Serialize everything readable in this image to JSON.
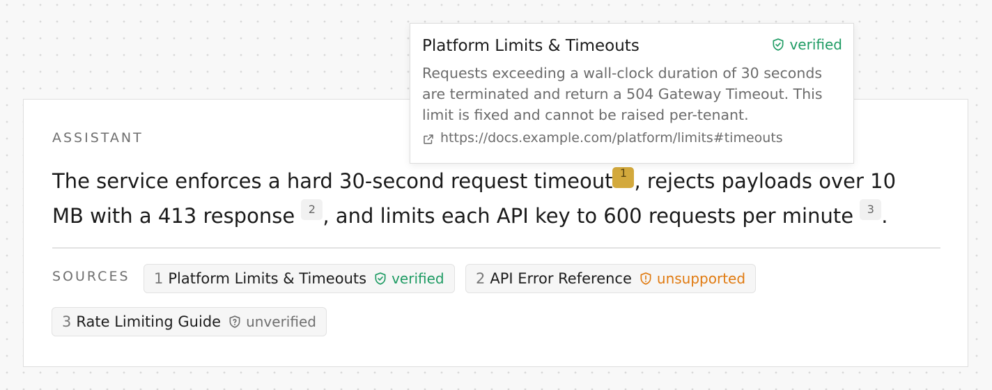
{
  "message": {
    "role_label": "ASSISTANT",
    "segments": [
      "The service enforces a hard 30-second request timeout",
      ", rejects payloads over 10 MB with a 413 response",
      ", and limits each API key to 600 requests per minute",
      "."
    ],
    "citations": [
      "1",
      "2",
      "3"
    ],
    "active_citation": "1"
  },
  "sources": {
    "label": "SOURCES",
    "items": [
      {
        "num": "1",
        "title": "Platform Limits & Timeouts",
        "status": "verified",
        "status_icon": "shield-check-icon"
      },
      {
        "num": "2",
        "title": "API Error Reference",
        "status": "unsupported",
        "status_icon": "shield-alert-icon"
      },
      {
        "num": "3",
        "title": "Rate Limiting Guide",
        "status": "unverified",
        "status_icon": "shield-question-icon"
      }
    ]
  },
  "popover": {
    "title": "Platform Limits & Timeouts",
    "status": "verified",
    "body": "Requests exceeding a wall-clock duration of 30 seconds are terminated and return a 504 Gateway Timeout. This limit is fixed and cannot be raised per-tenant.",
    "link": "https://docs.example.com/platform/limits#timeouts",
    "link_icon": "external-link-icon"
  },
  "colors": {
    "verified": "#1e9b63",
    "unsupported": "#e07a10",
    "unverified": "#6f6f6f",
    "active_citation": "#d3a93c",
    "card_border": "#dedede"
  }
}
